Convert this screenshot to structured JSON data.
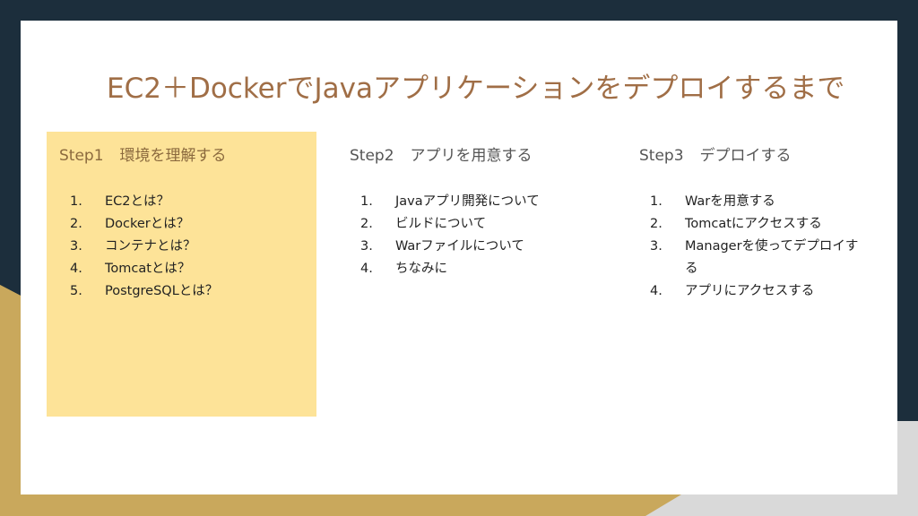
{
  "slide": {
    "title": "EC2＋DockerでJavaアプリケーションをデプロイするまで",
    "columns": [
      {
        "step": "Step1",
        "heading": "環境を理解する",
        "items": [
          {
            "num": "1.",
            "text": "EC2とは？"
          },
          {
            "num": "2.",
            "text": "Dockerとは？"
          },
          {
            "num": "3.",
            "text": "コンテナとは？"
          },
          {
            "num": "4.",
            "text": "Tomcatとは？"
          },
          {
            "num": "5.",
            "text": "PostgreSQLとは？"
          }
        ]
      },
      {
        "step": "Step2",
        "heading": "アプリを用意する",
        "items": [
          {
            "num": "1.",
            "text": "Javaアプリ開発について"
          },
          {
            "num": "2.",
            "text": "ビルドについて"
          },
          {
            "num": "3.",
            "text": "Warファイルについて"
          },
          {
            "num": "4.",
            "text": "ちなみに"
          }
        ]
      },
      {
        "step": "Step3",
        "heading": "デプロイする",
        "items": [
          {
            "num": "1.",
            "text": "Warを用意する"
          },
          {
            "num": "2.",
            "text": "Tomcatにアクセスする"
          },
          {
            "num": "3.",
            "text": "Managerを使ってデプロイする"
          },
          {
            "num": "4.",
            "text": "アプリにアクセスする"
          }
        ]
      }
    ]
  },
  "colors": {
    "background_dark": "#1c2e3c",
    "background_gold": "#c9a85c",
    "slide": "#ffffff",
    "title": "#a06e46",
    "highlight_box": "#fde398"
  }
}
